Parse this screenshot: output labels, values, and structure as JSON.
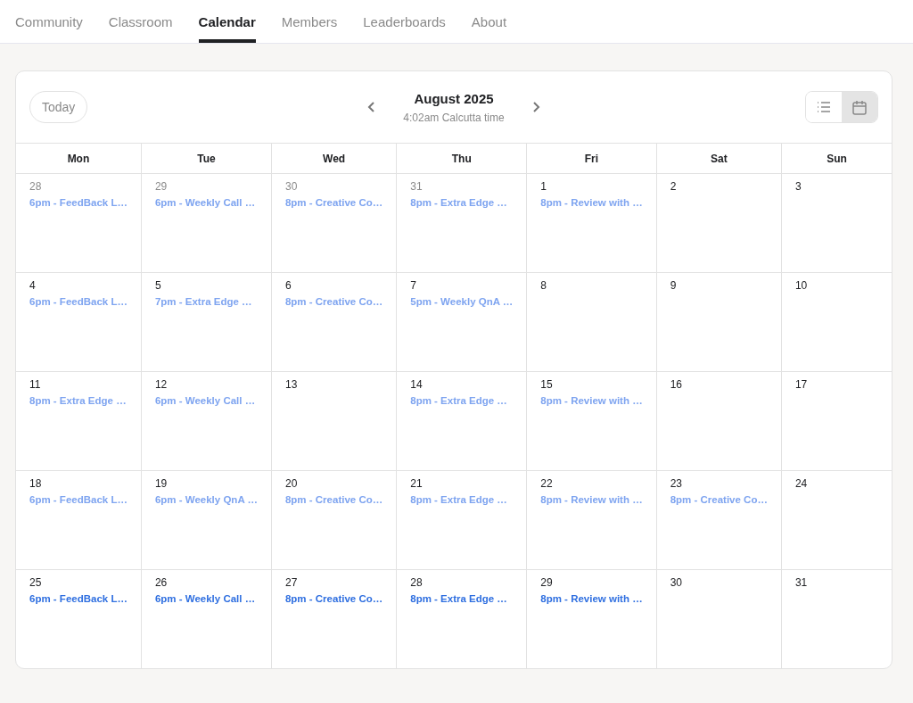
{
  "tabs": [
    {
      "label": "Community",
      "selected": false
    },
    {
      "label": "Classroom",
      "selected": false
    },
    {
      "label": "Calendar",
      "selected": true
    },
    {
      "label": "Members",
      "selected": false
    },
    {
      "label": "Leaderboards",
      "selected": false
    },
    {
      "label": "About",
      "selected": false
    }
  ],
  "calendar": {
    "today_button": "Today",
    "title": "August 2025",
    "subtitle": "4:02am Calcutta time",
    "views": [
      {
        "kind": "list",
        "selected": false
      },
      {
        "kind": "calendar",
        "selected": true
      }
    ],
    "weekdays": [
      "Mon",
      "Tue",
      "Wed",
      "Thu",
      "Fri",
      "Sat",
      "Sun"
    ],
    "weeks": [
      [
        {
          "day": "28",
          "outside": true,
          "events": [
            {
              "label": "6pm - FeedBack L…",
              "upcoming": false
            }
          ]
        },
        {
          "day": "29",
          "outside": true,
          "events": [
            {
              "label": "6pm - Weekly Call …",
              "upcoming": false
            }
          ]
        },
        {
          "day": "30",
          "outside": true,
          "events": [
            {
              "label": "8pm - Creative Co…",
              "upcoming": false
            }
          ]
        },
        {
          "day": "31",
          "outside": true,
          "events": [
            {
              "label": "8pm - Extra Edge …",
              "upcoming": false
            }
          ]
        },
        {
          "day": "1",
          "outside": false,
          "events": [
            {
              "label": "8pm - Review with …",
              "upcoming": false
            }
          ]
        },
        {
          "day": "2",
          "outside": false
        },
        {
          "day": "3",
          "outside": false
        }
      ],
      [
        {
          "day": "4",
          "outside": false,
          "events": [
            {
              "label": "6pm - FeedBack L…",
              "upcoming": false
            }
          ]
        },
        {
          "day": "5",
          "outside": false,
          "events": [
            {
              "label": "7pm - Extra Edge …",
              "upcoming": false
            }
          ]
        },
        {
          "day": "6",
          "outside": false,
          "events": [
            {
              "label": "8pm - Creative Co…",
              "upcoming": false
            }
          ]
        },
        {
          "day": "7",
          "outside": false,
          "events": [
            {
              "label": "5pm - Weekly QnA …",
              "upcoming": false
            }
          ]
        },
        {
          "day": "8",
          "outside": false
        },
        {
          "day": "9",
          "outside": false
        },
        {
          "day": "10",
          "outside": false
        }
      ],
      [
        {
          "day": "11",
          "outside": false,
          "events": [
            {
              "label": "8pm - Extra Edge …",
              "upcoming": false
            }
          ]
        },
        {
          "day": "12",
          "outside": false,
          "events": [
            {
              "label": "6pm - Weekly Call …",
              "upcoming": false
            }
          ]
        },
        {
          "day": "13",
          "outside": false
        },
        {
          "day": "14",
          "outside": false,
          "events": [
            {
              "label": "8pm - Extra Edge …",
              "upcoming": false
            }
          ]
        },
        {
          "day": "15",
          "outside": false,
          "events": [
            {
              "label": "8pm - Review with …",
              "upcoming": false
            }
          ]
        },
        {
          "day": "16",
          "outside": false
        },
        {
          "day": "17",
          "outside": false
        }
      ],
      [
        {
          "day": "18",
          "outside": false,
          "events": [
            {
              "label": "6pm - FeedBack L…",
              "upcoming": false
            }
          ]
        },
        {
          "day": "19",
          "outside": false,
          "events": [
            {
              "label": "6pm - Weekly QnA …",
              "upcoming": false
            }
          ]
        },
        {
          "day": "20",
          "outside": false,
          "events": [
            {
              "label": "8pm - Creative Co…",
              "upcoming": false
            }
          ]
        },
        {
          "day": "21",
          "outside": false,
          "events": [
            {
              "label": "8pm - Extra Edge …",
              "upcoming": false
            }
          ]
        },
        {
          "day": "22",
          "outside": false,
          "events": [
            {
              "label": "8pm - Review with …",
              "upcoming": false
            }
          ]
        },
        {
          "day": "23",
          "outside": false,
          "events": [
            {
              "label": "8pm - Creative Co…",
              "upcoming": false
            }
          ]
        },
        {
          "day": "24",
          "outside": false
        }
      ],
      [
        {
          "day": "25",
          "outside": false,
          "events": [
            {
              "label": "6pm - FeedBack L…",
              "upcoming": true
            }
          ]
        },
        {
          "day": "26",
          "outside": false,
          "events": [
            {
              "label": "6pm - Weekly Call …",
              "upcoming": true
            }
          ]
        },
        {
          "day": "27",
          "outside": false,
          "events": [
            {
              "label": "8pm - Creative Co…",
              "upcoming": true
            }
          ]
        },
        {
          "day": "28",
          "outside": false,
          "events": [
            {
              "label": "8pm - Extra Edge …",
              "upcoming": true
            }
          ]
        },
        {
          "day": "29",
          "outside": false,
          "events": [
            {
              "label": "8pm - Review with …",
              "upcoming": true
            }
          ]
        },
        {
          "day": "30",
          "outside": false
        },
        {
          "day": "31",
          "outside": false
        }
      ]
    ]
  }
}
